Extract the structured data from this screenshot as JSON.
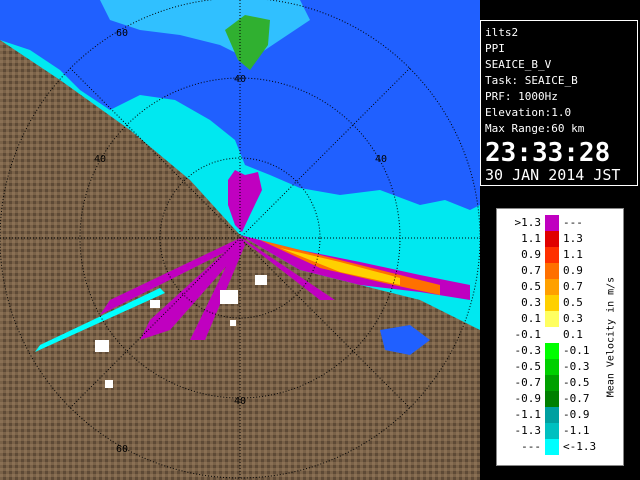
{
  "info": {
    "station": "ilts2",
    "scan_type": "PPI",
    "product": "SEAICE_B_V",
    "task": "Task: SEAICE_B",
    "prf": "PRF: 1000Hz",
    "elevation": "Elevation:1.0",
    "max_range": "Max Range:60 km",
    "time": "23:33:28",
    "date": "30 JAN 2014 JST"
  },
  "range_labels": [
    "40",
    "40",
    "40",
    "40",
    "60",
    "60"
  ],
  "legend": {
    "title": "Mean Velocity in m/s",
    "rows": [
      {
        "left": ">1.3",
        "color": "#c000c0",
        "right": "---"
      },
      {
        "left": "1.1",
        "color": "#e00000",
        "right": "1.3"
      },
      {
        "left": "0.9",
        "color": "#ff3000",
        "right": "1.1"
      },
      {
        "left": "0.7",
        "color": "#ff7000",
        "right": "0.9"
      },
      {
        "left": "0.5",
        "color": "#ffa000",
        "right": "0.7"
      },
      {
        "left": "0.3",
        "color": "#ffd000",
        "right": "0.5"
      },
      {
        "left": "0.1",
        "color": "#ffff60",
        "right": "0.3"
      },
      {
        "left": "-0.1",
        "color": "#ffffff",
        "right": "0.1"
      },
      {
        "left": "-0.3",
        "color": "#00ff00",
        "right": "-0.1"
      },
      {
        "left": "-0.5",
        "color": "#00d000",
        "right": "-0.3"
      },
      {
        "left": "-0.7",
        "color": "#00a000",
        "right": "-0.5"
      },
      {
        "left": "-0.9",
        "color": "#008000",
        "right": "-0.7"
      },
      {
        "left": "-1.1",
        "color": "#00a0a0",
        "right": "-0.9"
      },
      {
        "left": "-1.3",
        "color": "#00c0c0",
        "right": "-1.1"
      },
      {
        "left": "---",
        "color": "#00ffff",
        "right": "<-1.3"
      }
    ]
  },
  "colors": {
    "land": "#7a6248",
    "sea": "#00e8f0",
    "ice_blue": "#2060ff",
    "approach": "#c000c0"
  }
}
